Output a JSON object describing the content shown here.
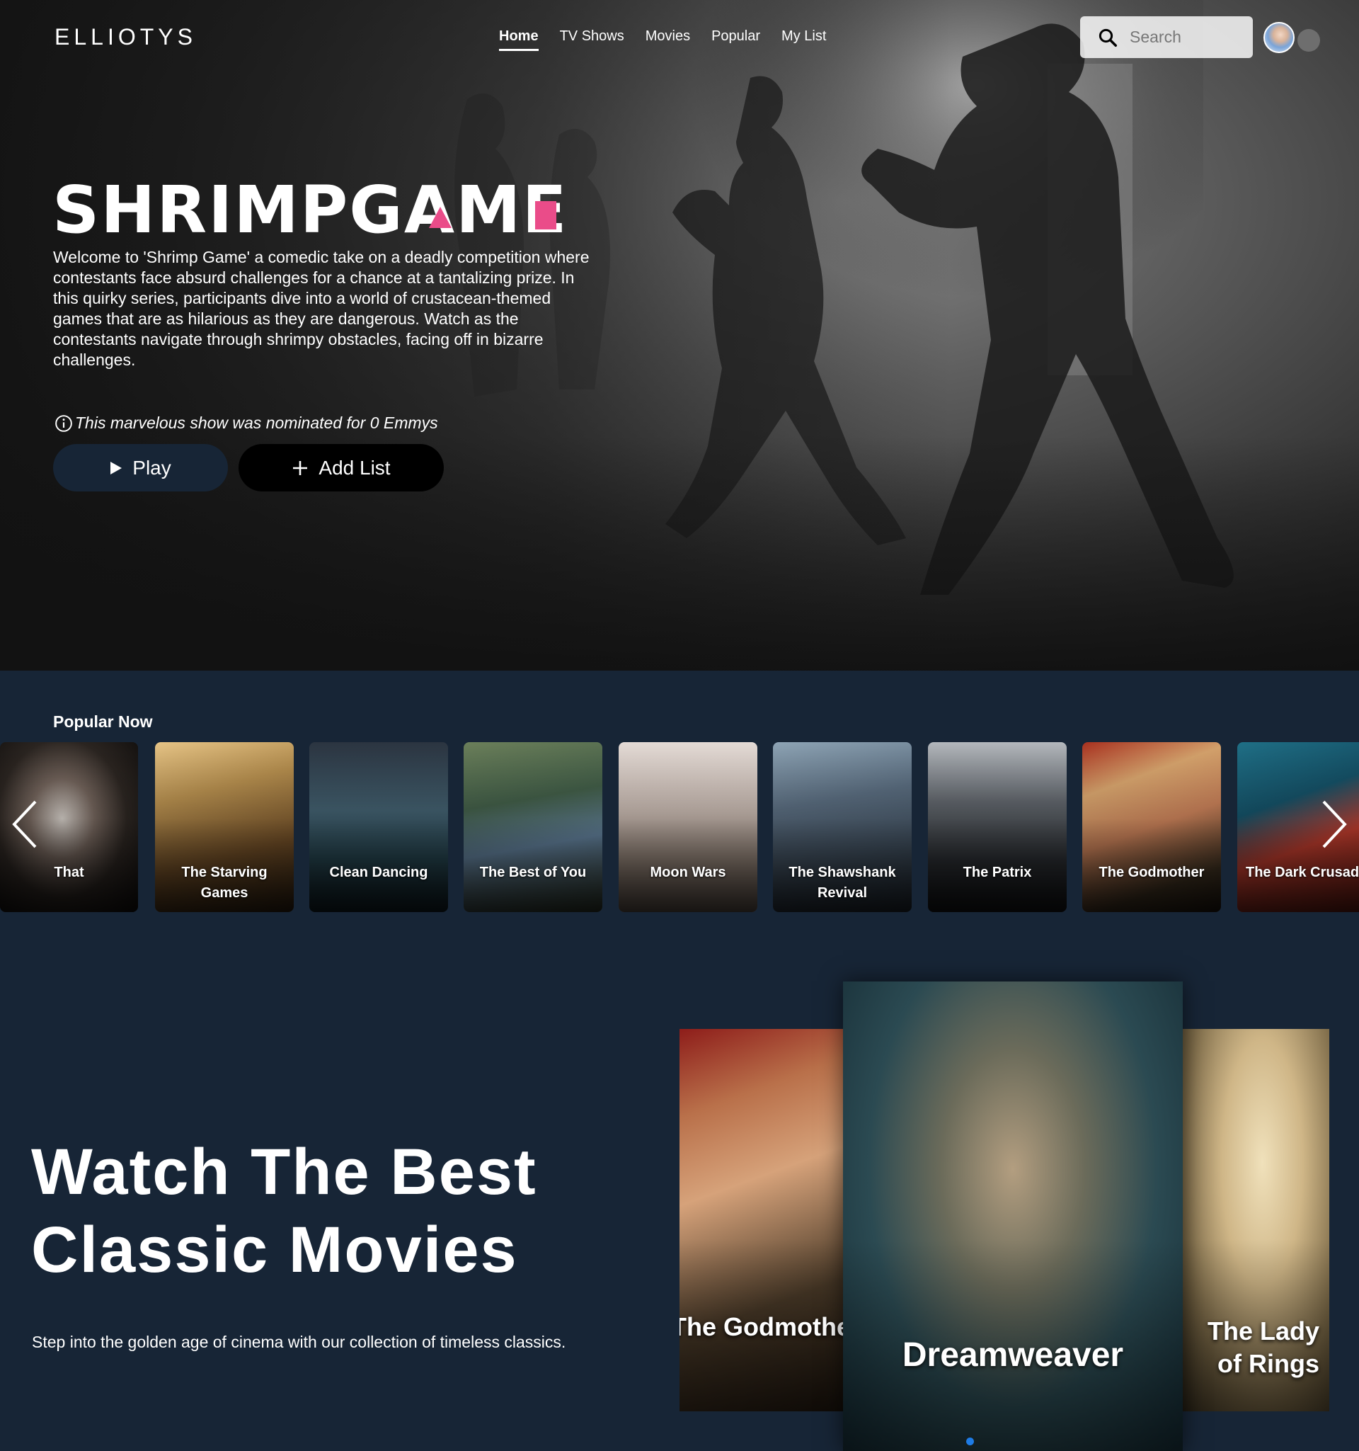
{
  "nav": {
    "logo": "ELLIOTYS",
    "links": [
      "Home",
      "TV Shows",
      "Movies",
      "Popular",
      "My List"
    ],
    "active": "Home",
    "search_placeholder": "Search"
  },
  "hero": {
    "show_logo": "SHRIMPGAME",
    "description": "Welcome to 'Shrimp Game' a comedic take on a deadly competition where contestants face absurd challenges for a chance at a tantalizing prize. In this quirky series, participants dive into a world of crustacean-themed games that are as hilarious as they are dangerous. Watch as the contestants navigate through shrimpy obstacles, facing off in bizarre challenges.",
    "emmy_note": "This marvelous show was nominated for 0 Emmys",
    "play_label": "Play",
    "add_list_label": "Add List",
    "accent_color": "#ea4c89"
  },
  "popular": {
    "title": "Popular Now",
    "items": [
      {
        "title": "That"
      },
      {
        "title": "The Starving Games"
      },
      {
        "title": "Clean Dancing"
      },
      {
        "title": "The Best of You"
      },
      {
        "title": "Moon Wars"
      },
      {
        "title": "The Shawshank Revival"
      },
      {
        "title": "The Patrix"
      },
      {
        "title": "The Godmother"
      },
      {
        "title": "The Dark Crusader"
      }
    ]
  },
  "classics": {
    "heading_line1": "Watch The Best",
    "heading_line2": "Classic Movies",
    "subtitle": "Step into the golden age of cinema with our collection of timeless classics.",
    "posters": {
      "left": "The Godmother",
      "center": "Dreamweaver",
      "right": "The Lady of Rings"
    },
    "active_dot_color": "#1e7be5"
  },
  "colors": {
    "page_bg": "#172536",
    "play_button": "#172536",
    "add_button": "#000000"
  }
}
